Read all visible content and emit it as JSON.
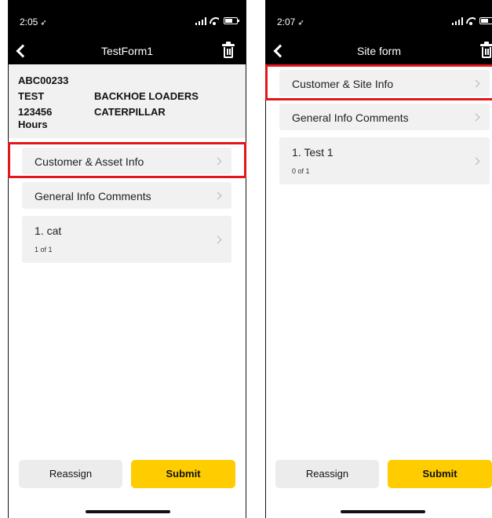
{
  "screens": [
    {
      "status_bar": {
        "time": "2:05",
        "location_glyph": "➶"
      },
      "nav": {
        "title": "TestForm1",
        "icons": {
          "back": "chevron-left-icon",
          "delete": "trash-icon"
        }
      },
      "asset_info": {
        "id": "ABC00233",
        "name": "TEST",
        "category": "BACKHOE LOADERS",
        "meter": "123456",
        "make": "CATERPILLAR",
        "unit": "Hours"
      },
      "menu": [
        {
          "label": "Customer & Asset Info"
        },
        {
          "label": "General Info Comments"
        },
        {
          "label": "1. cat",
          "progress": "1 of 1"
        }
      ],
      "buttons": {
        "reassign": "Reassign",
        "submit": "Submit"
      }
    },
    {
      "status_bar": {
        "time": "2:07",
        "location_glyph": "➶"
      },
      "nav": {
        "title": "Site form",
        "icons": {
          "back": "chevron-left-icon",
          "delete": "trash-icon"
        }
      },
      "menu": [
        {
          "label": "Customer & Site Info"
        },
        {
          "label": "General Info Comments"
        },
        {
          "label": "1. Test 1",
          "progress": "0 of 1"
        }
      ],
      "buttons": {
        "reassign": "Reassign",
        "submit": "Submit"
      }
    }
  ],
  "colors": {
    "highlight": "#e3161b",
    "submit": "#ffcc00",
    "bar": "#000000",
    "card": "#f1f1f1"
  }
}
